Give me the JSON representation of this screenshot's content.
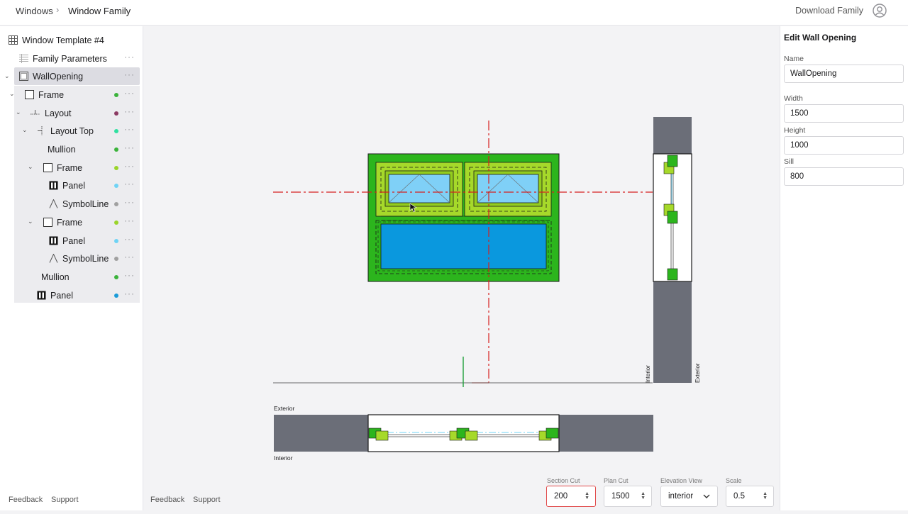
{
  "breadcrumb": {
    "root": "Windows",
    "current": "Window Family"
  },
  "header": {
    "download_label": "Download Family"
  },
  "tree": {
    "template_label": "Window Template #4",
    "family_params_label": "Family Parameters",
    "items": [
      {
        "label": "WallOpening",
        "dot": ""
      },
      {
        "label": "Frame",
        "dot": "#3bb33b"
      },
      {
        "label": "Layout",
        "dot": "#8b3a62"
      },
      {
        "label": "Layout Top",
        "dot": "#2fe0a0"
      },
      {
        "label": "Mullion",
        "dot": "#3bb33b"
      },
      {
        "label": "Frame",
        "dot": "#9ad42a"
      },
      {
        "label": "Panel",
        "dot": "#6fd3f5"
      },
      {
        "label": "SymbolLine",
        "dot": "#a0a0a0"
      },
      {
        "label": "Frame",
        "dot": "#9ad42a"
      },
      {
        "label": "Panel",
        "dot": "#6fd3f5"
      },
      {
        "label": "SymbolLine",
        "dot": "#a0a0a0"
      },
      {
        "label": "Mullion",
        "dot": "#3bb33b"
      },
      {
        "label": "Panel",
        "dot": "#1a9bd8"
      }
    ]
  },
  "footer": {
    "feedback": "Feedback",
    "support": "Support"
  },
  "edit_panel": {
    "title": "Edit Wall Opening",
    "name_label": "Name",
    "name_value": "WallOpening",
    "width_label": "Width",
    "width_value": "1500",
    "height_label": "Height",
    "height_value": "1000",
    "sill_label": "Sill",
    "sill_value": "800"
  },
  "controls": {
    "section_cut_label": "Section Cut",
    "section_cut_value": "200",
    "plan_cut_label": "Plan Cut",
    "plan_cut_value": "1500",
    "elevation_label": "Elevation View",
    "elevation_value": "interior",
    "scale_label": "Scale",
    "scale_value": "0.5"
  },
  "drawing": {
    "exterior_label": "Exterior",
    "interior_label": "Interior",
    "side_interior_label": "Interior",
    "side_exterior_label": "Exterior"
  },
  "colors": {
    "frame_green": "#2cb51d",
    "sash_green": "#a6d92a",
    "glass_light": "#7fd0f7",
    "glass_blue": "#0a98de",
    "wall_gray": "#6b6e78",
    "center_line_red": "#d62020",
    "accent_red": "#e14b4b"
  }
}
